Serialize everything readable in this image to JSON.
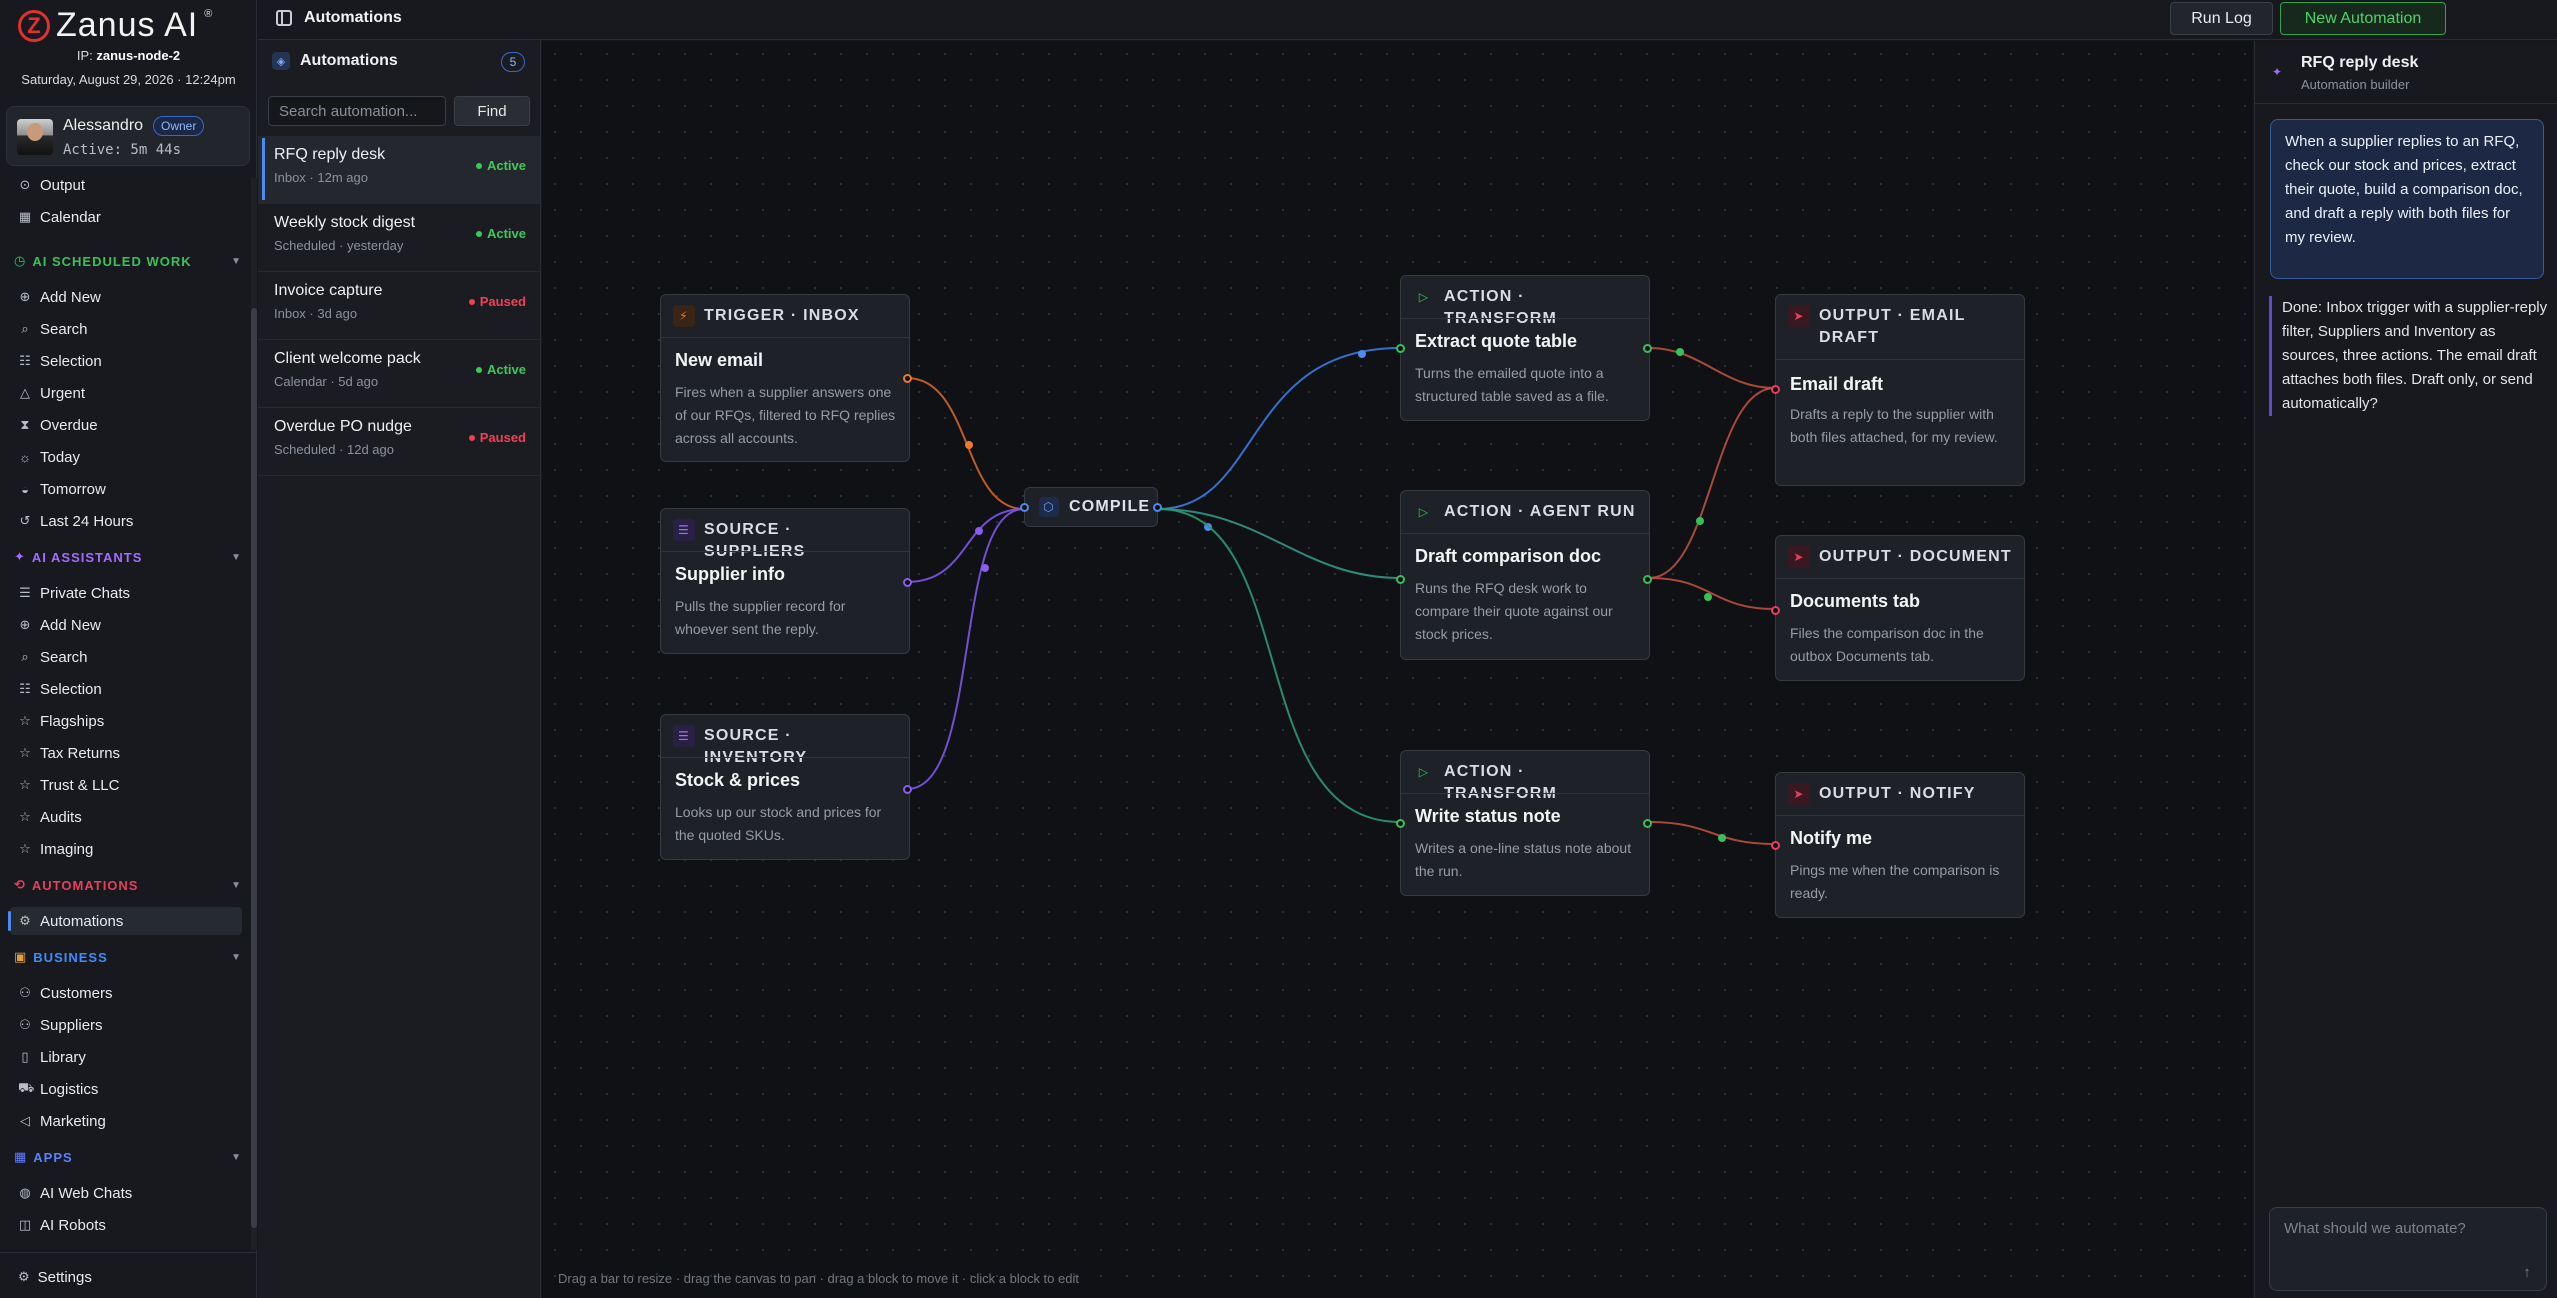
{
  "brand": {
    "name": "Zanus AI",
    "reg": "®"
  },
  "node_info": {
    "ip_label": "IP:",
    "ip_value": "zanus-node-2",
    "datetime": "Saturday, August 29, 2026 · 12:24pm"
  },
  "user": {
    "name": "Alessandro",
    "role": "Owner",
    "active": "Active: 5m 44s"
  },
  "sidebar": {
    "top_items": [
      {
        "label": "Output",
        "icon": "output-icon"
      },
      {
        "label": "Calendar",
        "icon": "calendar-icon"
      }
    ],
    "sections": [
      {
        "title": "AI SCHEDULED WORK",
        "color": "#35c35a",
        "items": [
          "Add New",
          "Search",
          "Selection",
          "Urgent",
          "Overdue",
          "Today",
          "Tomorrow",
          "Last 24 Hours"
        ]
      },
      {
        "title": "AI ASSISTANTS",
        "color": "#a46cff",
        "items": [
          "Private Chats",
          "Add New",
          "Search",
          "Selection",
          "Flagships",
          "Tax Returns",
          "Trust & LLC",
          "Audits",
          "Imaging"
        ]
      },
      {
        "title": "AUTOMATIONS",
        "color": "#e83f5d",
        "items": [
          "Automations"
        ]
      },
      {
        "title": "BUSINESS",
        "color": "#3f8cff",
        "items": [
          "Customers",
          "Suppliers",
          "Library",
          "Logistics",
          "Marketing"
        ]
      },
      {
        "title": "APPS",
        "color": "#5f7dff",
        "items": [
          "AI Web Chats",
          "AI Robots"
        ]
      }
    ],
    "settings": "Settings"
  },
  "list": {
    "title": "Automations",
    "count": "5",
    "search_placeholder": "Search automation...",
    "find": "Find",
    "items": [
      {
        "title": "RFQ reply desk",
        "sub": "Inbox · 12m ago",
        "status": "Active"
      },
      {
        "title": "Weekly stock digest",
        "sub": "Scheduled · yesterday",
        "status": "Active"
      },
      {
        "title": "Invoice capture",
        "sub": "Inbox · 3d ago",
        "status": "Paused"
      },
      {
        "title": "Client welcome pack",
        "sub": "Calendar · 5d ago",
        "status": "Active"
      },
      {
        "title": "Overdue PO nudge",
        "sub": "Scheduled · 12d ago",
        "status": "Paused"
      }
    ]
  },
  "topbar": {
    "title": "Automations",
    "run_log": "Run Log",
    "new_automation": "New Automation"
  },
  "colors": {
    "active": "#3cc95b",
    "paused": "#ef4058",
    "trigger": "#f07a2a",
    "source": "#8a5cf0",
    "action": "#36c15a",
    "output": "#e83f5d",
    "compile": "#4d8bf0"
  },
  "canvas": {
    "compile": "COMPILE",
    "hint": "Drag a bar to resize · drag the canvas to pan · drag a block to move it · click a block to edit",
    "nodes": {
      "trigger": {
        "kind": "TRIGGER · INBOX",
        "title": "New email",
        "desc": "Fires when a supplier answers one of our RFQs, filtered to RFQ replies across all accounts."
      },
      "suppliers": {
        "kind": "SOURCE · SUPPLIERS",
        "title": "Supplier info",
        "desc": "Pulls the supplier record for whoever sent the reply."
      },
      "inventory": {
        "kind": "SOURCE · INVENTORY",
        "title": "Stock & prices",
        "desc": "Looks up our stock and prices for the quoted SKUs."
      },
      "extract": {
        "kind": "ACTION · TRANSFORM",
        "title": "Extract quote table",
        "desc": "Turns the emailed quote into a structured table saved as a file."
      },
      "draftdoc": {
        "kind": "ACTION · AGENT RUN",
        "title": "Draft comparison doc",
        "desc": "Runs the RFQ desk work to compare their quote against our stock prices."
      },
      "status": {
        "kind": "ACTION · TRANSFORM",
        "title": "Write status note",
        "desc": "Writes a one-line status note about the run."
      },
      "email": {
        "kind": "OUTPUT · EMAIL DRAFT",
        "title": "Email draft",
        "desc": "Drafts a reply to the supplier with both files attached, for my review."
      },
      "documents": {
        "kind": "OUTPUT · DOCUMENT",
        "title": "Documents tab",
        "desc": "Files the comparison doc in the outbox Documents tab."
      },
      "notify": {
        "kind": "OUTPUT · NOTIFY",
        "title": "Notify me",
        "desc": "Pings me when the comparison is ready."
      }
    }
  },
  "chat": {
    "title": "RFQ reply desk",
    "subtitle": "Automation builder",
    "user_message": "When a supplier replies to an RFQ, check our stock and prices, extract their quote, build a comparison doc, and draft a reply with both files for my review.",
    "bot_message": "Done: Inbox trigger with a supplier-reply filter, Suppliers and Inventory as sources, three actions. The email draft attaches both files. Draft only, or send automatically?",
    "input_placeholder": "What should we automate?"
  }
}
